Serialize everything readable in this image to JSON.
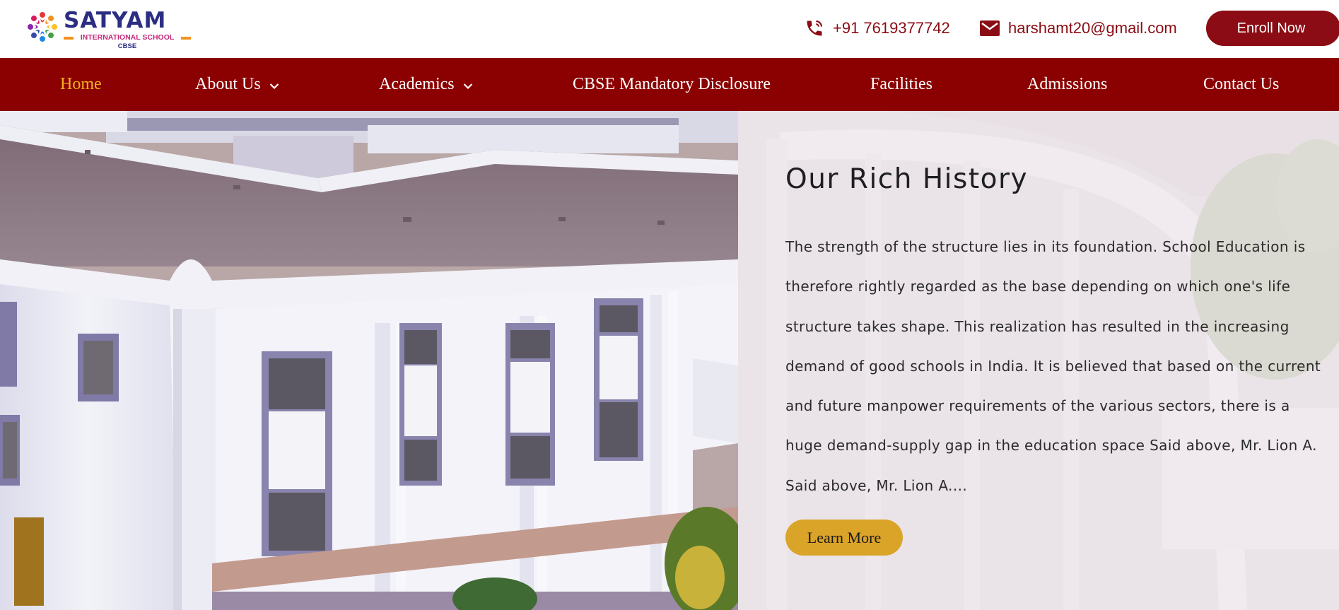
{
  "header": {
    "logo": {
      "name": "SATYAM",
      "subtitle": "INTERNATIONAL SCHOOL",
      "board": "CBSE"
    },
    "phone": "+91 7619377742",
    "email": "harshamt20@gmail.com",
    "enroll_label": "Enroll Now",
    "accent_color": "#8b0c14"
  },
  "nav": {
    "items": [
      {
        "label": "Home",
        "active": true
      },
      {
        "label": "About Us",
        "dropdown": true
      },
      {
        "label": "Academics",
        "dropdown": true
      },
      {
        "label": "CBSE Mandatory Disclosure"
      },
      {
        "label": "Facilities"
      },
      {
        "label": "Admissions"
      },
      {
        "label": "Contact Us"
      }
    ],
    "background_color": "#8b0000",
    "active_color": "#f4b21f"
  },
  "hero": {
    "title": "Our Rich History",
    "body": "The strength of the structure lies in its foundation. School Education is therefore rightly regarded as the base depending on which one's life structure takes shape. This realization has resulted in the increasing demand of good schools in India. It is believed that based on the current and future manpower requirements of the various sectors, there is a huge demand-supply gap in the education space Said above, Mr. Lion A. Said above, Mr. Lion A....",
    "button_label": "Learn More",
    "button_color": "#daa429"
  },
  "icons": {
    "phone": "phone-icon",
    "email": "mail-icon",
    "dropdown": "chevron-down-icon",
    "logo": "people-circle-logo-icon"
  }
}
